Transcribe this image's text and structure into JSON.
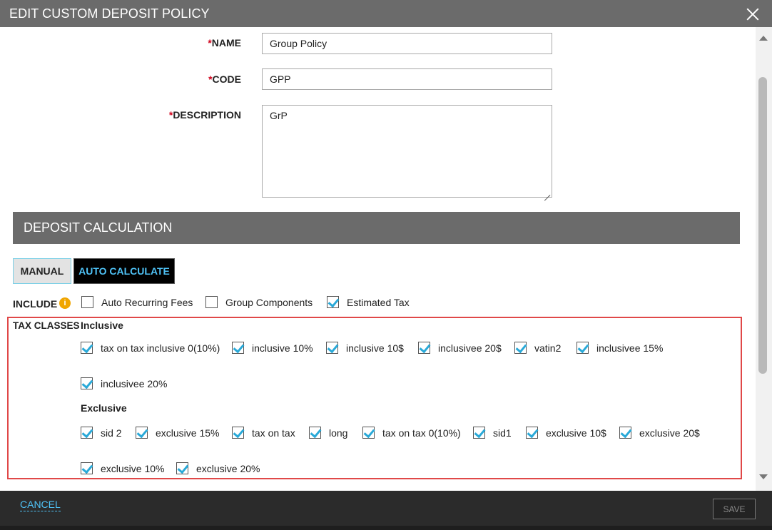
{
  "dialog": {
    "title": "EDIT CUSTOM DEPOSIT POLICY"
  },
  "form": {
    "required_mark": "*",
    "name": {
      "label": "NAME",
      "value": "Group Policy"
    },
    "code": {
      "label": "CODE",
      "value": "GPP"
    },
    "description": {
      "label": "DESCRIPTION",
      "value": "GrP"
    }
  },
  "deposit_calculation": {
    "heading": "DEPOSIT CALCULATION",
    "modes": [
      {
        "label": "MANUAL",
        "active": false
      },
      {
        "label": "AUTO CALCULATE",
        "active": true
      }
    ]
  },
  "include": {
    "label": "INCLUDE",
    "info_icon": "info-icon",
    "options": [
      {
        "label": "Auto Recurring Fees",
        "checked": false
      },
      {
        "label": "Group Components",
        "checked": false
      },
      {
        "label": "Estimated Tax",
        "checked": true
      }
    ]
  },
  "tax_classes": {
    "label": "TAX CLASSES",
    "inclusive": {
      "label": "Inclusive",
      "items": [
        {
          "label": "tax on tax inclusive 0(10%)",
          "checked": true
        },
        {
          "label": "inclusive 10%",
          "checked": true
        },
        {
          "label": "inclusive 10$",
          "checked": true
        },
        {
          "label": "inclusivee 20$",
          "checked": true
        },
        {
          "label": "vatin2",
          "checked": true
        },
        {
          "label": "inclusivee 15%",
          "checked": true
        },
        {
          "label": "inclusivee 20%",
          "checked": true
        }
      ]
    },
    "exclusive": {
      "label": "Exclusive",
      "items": [
        {
          "label": "sid 2",
          "checked": true
        },
        {
          "label": "exclusive 15%",
          "checked": true
        },
        {
          "label": "tax on tax",
          "checked": true
        },
        {
          "label": "long",
          "checked": true
        },
        {
          "label": "tax on tax 0(10%)",
          "checked": true
        },
        {
          "label": "sid1",
          "checked": true
        },
        {
          "label": "exclusive 10$",
          "checked": true
        },
        {
          "label": "exclusive 20$",
          "checked": true
        },
        {
          "label": "exclusive 10%",
          "checked": true
        },
        {
          "label": "exclusive 20%",
          "checked": true
        }
      ]
    }
  },
  "footer": {
    "cancel_label": "CANCEL",
    "save_label": "SAVE"
  },
  "colors": {
    "title_bar": "#6b6b6b",
    "accent": "#4fc3f7",
    "checkmark": "#29a9d8",
    "required": "#d0021b",
    "highlight_border": "#e04848"
  }
}
